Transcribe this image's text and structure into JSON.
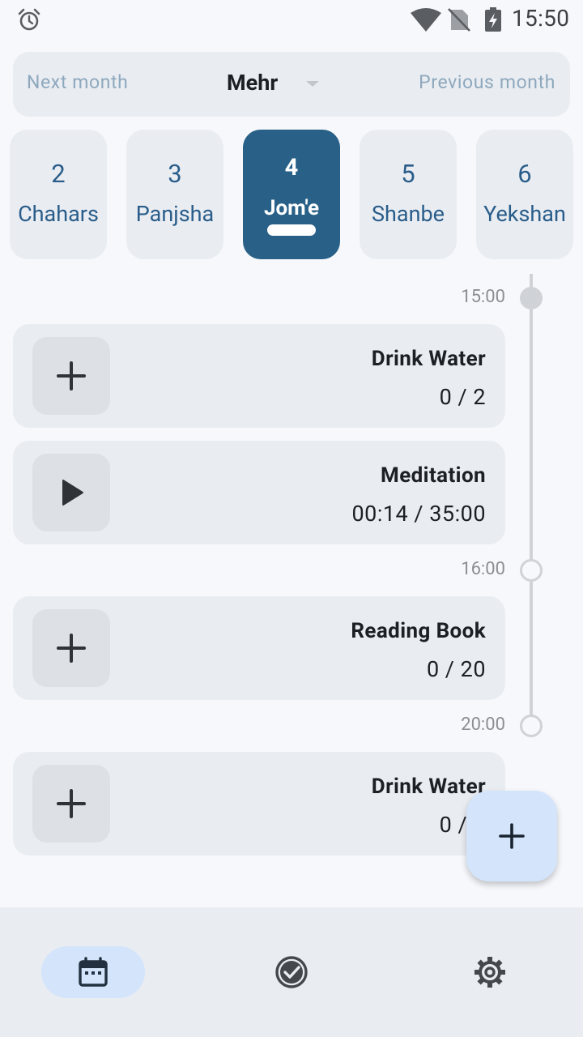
{
  "status_bar": {
    "time": "15:50",
    "icons": [
      "alarm-icon",
      "wifi-icon",
      "no-sim-icon",
      "battery-charging-icon"
    ]
  },
  "month_nav": {
    "next_label": "Next month",
    "current_month": "Mehr",
    "previous_label": "Previous month"
  },
  "days": [
    {
      "number": "2",
      "name": "Chahars",
      "selected": false
    },
    {
      "number": "3",
      "name": "Panjsha",
      "selected": false
    },
    {
      "number": "4",
      "name": "Jom'e",
      "selected": true
    },
    {
      "number": "5",
      "name": "Shanbe",
      "selected": false
    },
    {
      "number": "6",
      "name": "Yekshan",
      "selected": false
    }
  ],
  "timeline": {
    "times": [
      "15:00",
      "16:00",
      "20:00"
    ]
  },
  "tasks": [
    {
      "title": "Drink Water",
      "progress": "0 / 2",
      "action_icon": "plus-icon"
    },
    {
      "title": "Meditation",
      "progress": "00:14 / 35:00",
      "action_icon": "play-icon"
    },
    {
      "title": "Reading Book",
      "progress": "0 / 20",
      "action_icon": "plus-icon"
    },
    {
      "title": "Drink Water",
      "progress": "0 / 2",
      "action_icon": "plus-icon"
    }
  ],
  "fab": {
    "icon": "plus-icon"
  },
  "bottom_nav": {
    "items": [
      {
        "icon": "calendar-icon",
        "active": true
      },
      {
        "icon": "check-circle-icon",
        "active": false
      },
      {
        "icon": "settings-gear-icon",
        "active": false
      }
    ]
  },
  "colors": {
    "background": "#f6f8fc",
    "card": "#e9edf2",
    "selected_day": "#286087",
    "day_text": "#2a5d8a",
    "accent_light": "#d3e4fb",
    "muted_text": "#8ea8bd"
  }
}
